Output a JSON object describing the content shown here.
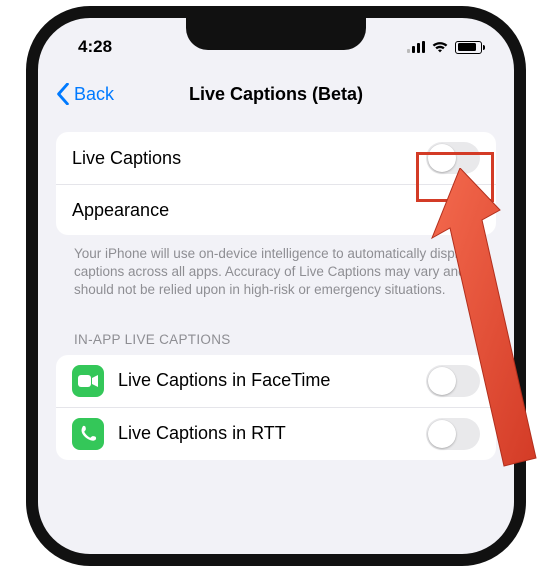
{
  "status": {
    "time": "4:28"
  },
  "nav": {
    "back_label": "Back",
    "title": "Live Captions (Beta)"
  },
  "group1": {
    "live_captions_label": "Live Captions",
    "appearance_label": "Appearance"
  },
  "footer1": "Your iPhone will use on-device intelligence to automatically display captions across all apps. Accuracy of Live Captions may vary and should not be relied upon in high-risk or emergency situations.",
  "section2_header": "IN-APP LIVE CAPTIONS",
  "group2": {
    "facetime_label": "Live Captions in FaceTime",
    "rtt_label": "Live Captions in RTT"
  },
  "toggles": {
    "live_captions": false,
    "facetime": false,
    "rtt": false
  }
}
